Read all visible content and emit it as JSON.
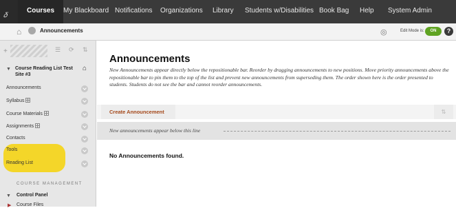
{
  "top_nav": {
    "corner_glyph": "𝛿",
    "tabs": [
      {
        "label": "Courses",
        "active": true
      },
      {
        "label": "My Blackboard",
        "active": false
      },
      {
        "label": "Notifications",
        "active": false
      },
      {
        "label": "Organizations",
        "active": false
      },
      {
        "label": "Library",
        "active": false
      },
      {
        "label": "Students w/Disabilities",
        "active": false
      },
      {
        "label": "Book Bag",
        "active": false
      },
      {
        "label": "Help",
        "active": false
      },
      {
        "label": "System Admin",
        "active": false
      }
    ]
  },
  "breadcrumb": {
    "title": "Announcements",
    "edit_mode_label": "Edit Mode is:",
    "edit_mode_state": "ON",
    "help_label": "?"
  },
  "sidebar": {
    "course_title": "Course Reading List Test Site #3",
    "items": [
      {
        "label": "Announcements"
      },
      {
        "label": "Syllabus"
      },
      {
        "label": "Course Materials"
      },
      {
        "label": "Assignments"
      },
      {
        "label": "Contacts"
      },
      {
        "label": "Tools"
      },
      {
        "label": "Reading List"
      }
    ],
    "management_heading": "COURSE MANAGEMENT",
    "control_panel_label": "Control Panel",
    "course_files_label": "Course Files"
  },
  "main": {
    "page_title": "Announcements",
    "description": "New Announcements appear directly below the repositionable bar. Reorder by dragging announcements to new positions. Move priority announcements above the repositionable bar to pin them to the top of the list and prevent new announcements from superseding them. The order shown here is the order presented to students. Students do not see the bar and cannot reorder announcements.",
    "create_button": "Create Announcement",
    "separator_text": "New announcements appear below this line",
    "empty_message": "No Announcements found."
  },
  "colors": {
    "top_nav_bg": "#3a3a3a",
    "highlight": "#f4d51f",
    "edit_on": "#5fa322",
    "create_link": "#a4481a"
  }
}
